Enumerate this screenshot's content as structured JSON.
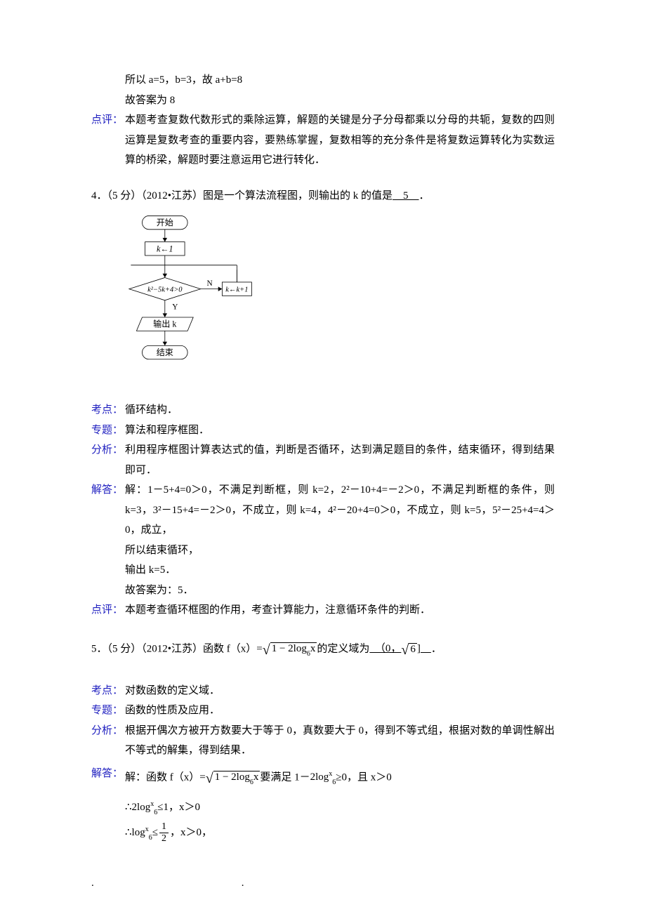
{
  "block3": {
    "solve1": "所以 a=5，b=3，故 a+b=8",
    "solve2": "故答案为 8",
    "pingLabel": "点评：",
    "ping": "本题考查复数代数形式的乘除运算，解题的关键是分子分母都乘以分母的共轭，复数的四则运算是复数考查的重要内容，要熟练掌握，复数相等的充分条件是将复数运算转化为实数运算的桥梁，解题时要注意运用它进行转化．"
  },
  "q4": {
    "stem_a": "4．（5 分）（2012•江苏）图是一个算法流程图，则输出的 k 的值是",
    "answer": "　5　",
    "stem_b": "．",
    "flow": {
      "start": "开始",
      "init": "k←1",
      "cond": "k²−5k+4>0",
      "n": "N",
      "y": "Y",
      "upd": "k←k+1",
      "out": "输出 k",
      "end": "结束"
    },
    "kaoLabel": "考点：",
    "kao": "循环结构．",
    "zhuanLabel": "专题：",
    "zhuan": "算法和程序框图．",
    "fenLabel": "分析：",
    "fen": "利用程序框图计算表达式的值，判断是否循环，达到满足题目的条件，结束循环，得到结果即可．",
    "jieLabel": "解答：",
    "jie1": "解：1－5+4=0＞0，不满足判断框，则 k=2，2²－10+4=－2＞0，不满足判断框的条件，则 k=3，3²－15+4=－2＞0，不成立，则 k=4，4²－20+4=0＞0，不成立，则 k=5，5²－25+4=4＞0，成立，",
    "jie2": "所以结束循环，",
    "jie3": "输出 k=5．",
    "jie4": "故答案为：5．",
    "pingLabel": "点评：",
    "ping": "本题考查循环框图的作用，考查计算能力，注意循环条件的判断．"
  },
  "q5": {
    "stem_a": "5．（5 分）（2012•江苏）函数 f（x）=",
    "sqrt_text": "1 − 2log",
    "sqrt_sub": "6",
    "sqrt_tail": "x",
    "stem_b": "的定义域为",
    "ans_a": "　（0，",
    "ans_root": "6",
    "ans_b": "]　",
    "stem_c": "．",
    "kaoLabel": "考点：",
    "kao": "对数函数的定义域．",
    "zhuanLabel": "专题：",
    "zhuan": "函数的性质及应用．",
    "fenLabel": "分析：",
    "fen": "根据开偶次方被开方数要大于等于 0，真数要大于 0，得到不等式组，根据对数的单调性解出不等式的解集，得到结果．",
    "jieLabel": "解答：",
    "jie1a": "解：函数 f（x）=",
    "jie1b": "要满足 1－",
    "jie1c": "≥0，且 x＞0",
    "jie2a": "∴",
    "jie2b": "≤1，x＞0",
    "jie3a": "∴",
    "jie3b": "≤",
    "jie3c": "，x＞0，"
  },
  "log_2": "2log",
  "log_1": "log",
  "log_sub": "6",
  "log_sup": "x",
  "frac": {
    "num": "1",
    "den": "2"
  },
  "dot": "."
}
